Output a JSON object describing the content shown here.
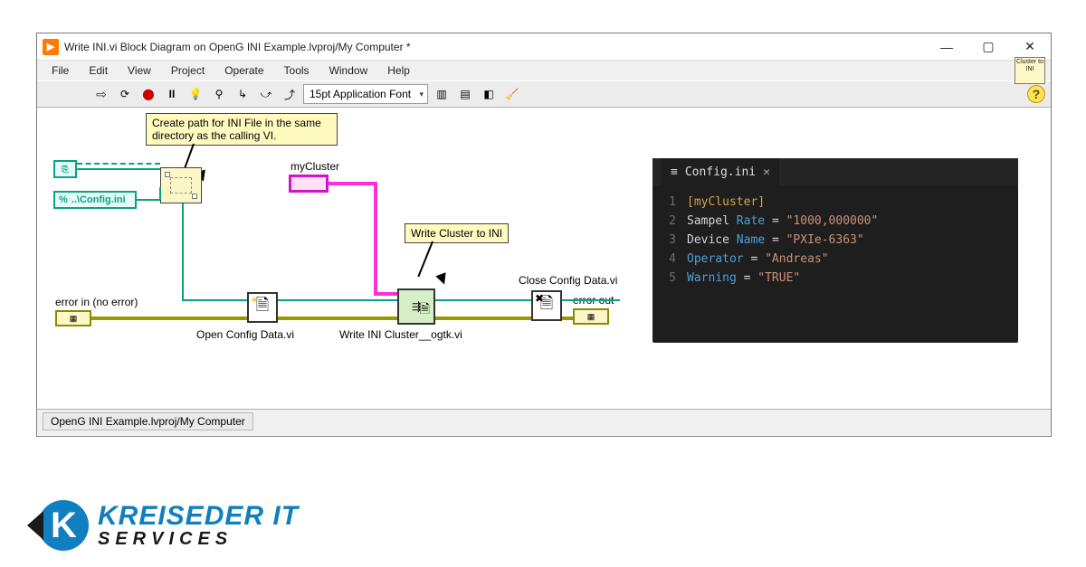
{
  "window": {
    "title": "Write INI.vi Block Diagram on OpenG INI Example.lvproj/My Computer *"
  },
  "menus": [
    "File",
    "Edit",
    "View",
    "Project",
    "Operate",
    "Tools",
    "Window",
    "Help"
  ],
  "toolbar": {
    "font": "15pt Application Font"
  },
  "clusterThumb": "Cluster to INI",
  "diagram": {
    "comment1": "Create path for INI File in the same directory as the calling VI.",
    "comment2": "Write Cluster to INI",
    "configPath": "..\\Config.ini",
    "myClusterLabel": "myCluster",
    "errorInLabel": "error in (no error)",
    "errorOutLabel": "error out",
    "closeLabel": "Close Config Data.vi",
    "openLabel": "Open Config Data.vi",
    "writeLabel": "Write INI Cluster__ogtk.vi"
  },
  "editor": {
    "tabName": "Config.ini",
    "lines": [
      {
        "n": 1,
        "section": "[myCluster]"
      },
      {
        "n": 2,
        "k1": "Sampel",
        "k2": "Rate",
        "val": "\"1000,000000\""
      },
      {
        "n": 3,
        "k1": "Device",
        "k2": "Name",
        "val": "\"PXIe-6363\""
      },
      {
        "n": 4,
        "k1": "Operator",
        "val": "\"Andreas\""
      },
      {
        "n": 5,
        "k1": "Warning",
        "val": "\"TRUE\""
      }
    ]
  },
  "status": "OpenG INI Example.lvproj/My Computer",
  "logo": {
    "line1": "KREISEDER IT",
    "line2": "SERVICES"
  }
}
